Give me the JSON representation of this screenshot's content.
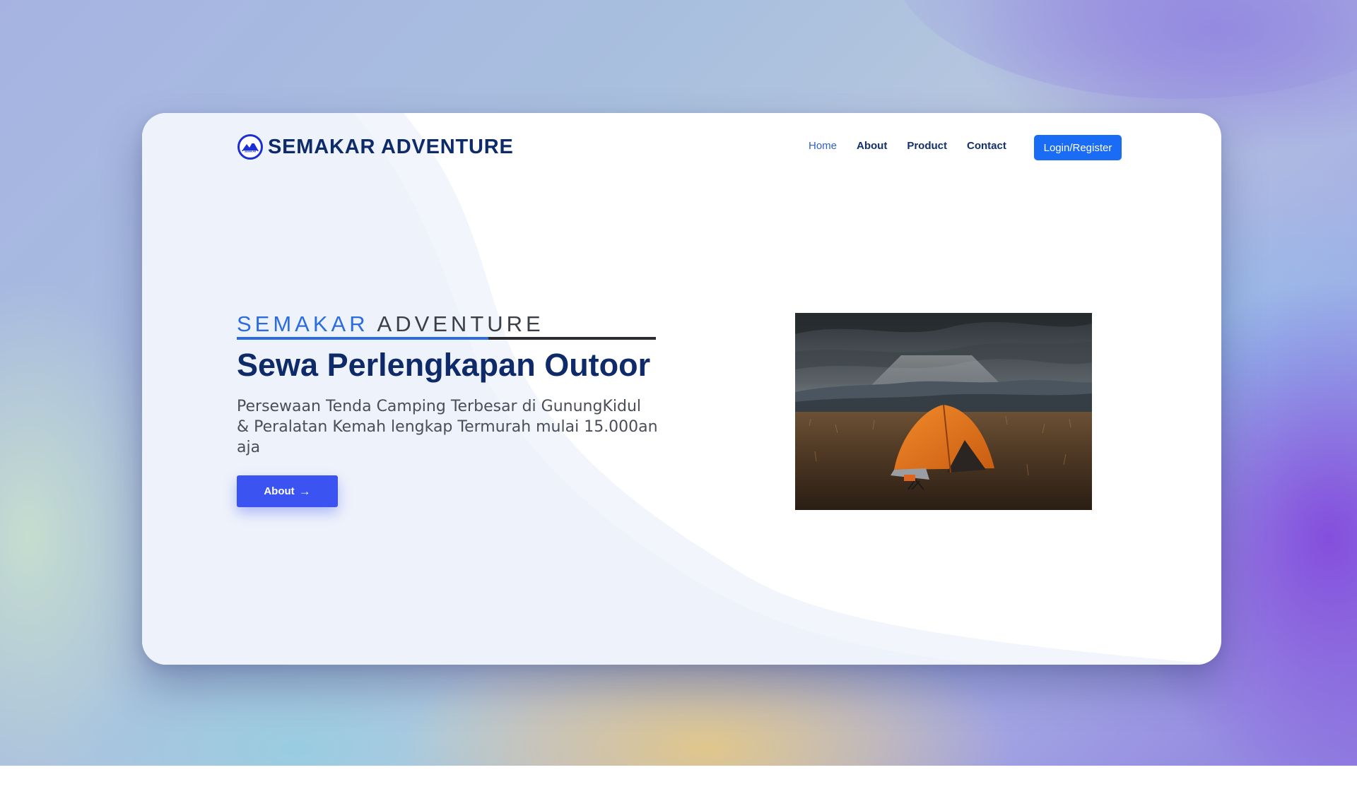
{
  "brand": {
    "name": "SEMAKAR ADVENTURE",
    "logo_icon": "mountain-logo-icon",
    "logo_mark_text": "SEMAKAR"
  },
  "nav": {
    "items": [
      {
        "label": "Home",
        "active": true
      },
      {
        "label": "About",
        "active": false
      },
      {
        "label": "Product",
        "active": false
      },
      {
        "label": "Contact",
        "active": false
      }
    ],
    "login_label": "Login/Register"
  },
  "hero": {
    "eyebrow_accent": "SEMAKAR",
    "eyebrow_rest": "ADVENTURE",
    "headline": "Sewa Perlengkapan Outoor",
    "subtitle": "Persewaan Tenda Camping Terbesar di GunungKidul & Peralatan Kemah lengkap Termurah mulai 15.000an aja",
    "cta_label": "About",
    "cta_icon": "arrow-right-icon"
  },
  "colors": {
    "accent": "#2b6de0",
    "primary_dark": "#0f2a68",
    "button_blue": "#1a6cf5",
    "cta_blue": "#3b53f0"
  }
}
